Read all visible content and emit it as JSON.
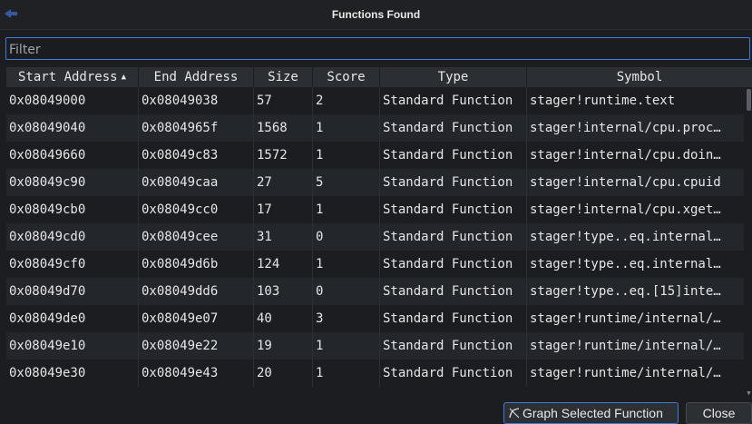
{
  "window": {
    "title": "Functions Found"
  },
  "filter": {
    "placeholder": "Filter",
    "value": ""
  },
  "table": {
    "columns": [
      {
        "label": "Start Address",
        "sort": "ascending"
      },
      {
        "label": "End Address"
      },
      {
        "label": "Size"
      },
      {
        "label": "Score"
      },
      {
        "label": "Type"
      },
      {
        "label": "Symbol"
      }
    ],
    "rows": [
      [
        "0x08049000",
        "0x08049038",
        "57",
        "2",
        "Standard Function",
        "stager!runtime.text"
      ],
      [
        "0x08049040",
        "0x0804965f",
        "1568",
        "1",
        "Standard Function",
        "stager!internal/cpu.proc…"
      ],
      [
        "0x08049660",
        "0x08049c83",
        "1572",
        "1",
        "Standard Function",
        "stager!internal/cpu.doin…"
      ],
      [
        "0x08049c90",
        "0x08049caa",
        "27",
        "5",
        "Standard Function",
        "stager!internal/cpu.cpuid"
      ],
      [
        "0x08049cb0",
        "0x08049cc0",
        "17",
        "1",
        "Standard Function",
        "stager!internal/cpu.xget…"
      ],
      [
        "0x08049cd0",
        "0x08049cee",
        "31",
        "0",
        "Standard Function",
        "stager!type..eq.internal…"
      ],
      [
        "0x08049cf0",
        "0x08049d6b",
        "124",
        "1",
        "Standard Function",
        "stager!type..eq.internal…"
      ],
      [
        "0x08049d70",
        "0x08049dd6",
        "103",
        "0",
        "Standard Function",
        "stager!type..eq.[15]inte…"
      ],
      [
        "0x08049de0",
        "0x08049e07",
        "40",
        "3",
        "Standard Function",
        "stager!runtime/internal/…"
      ],
      [
        "0x08049e10",
        "0x08049e22",
        "19",
        "1",
        "Standard Function",
        "stager!runtime/internal/…"
      ],
      [
        "0x08049e30",
        "0x08049e43",
        "20",
        "1",
        "Standard Function",
        "stager!runtime/internal/…"
      ]
    ]
  },
  "buttons": {
    "graph_selected": "Graph Selected Function",
    "close": "Close"
  },
  "colors": {
    "accent": "#3c7fd9",
    "background": "#1b1d21",
    "header": "#2b2e33"
  }
}
